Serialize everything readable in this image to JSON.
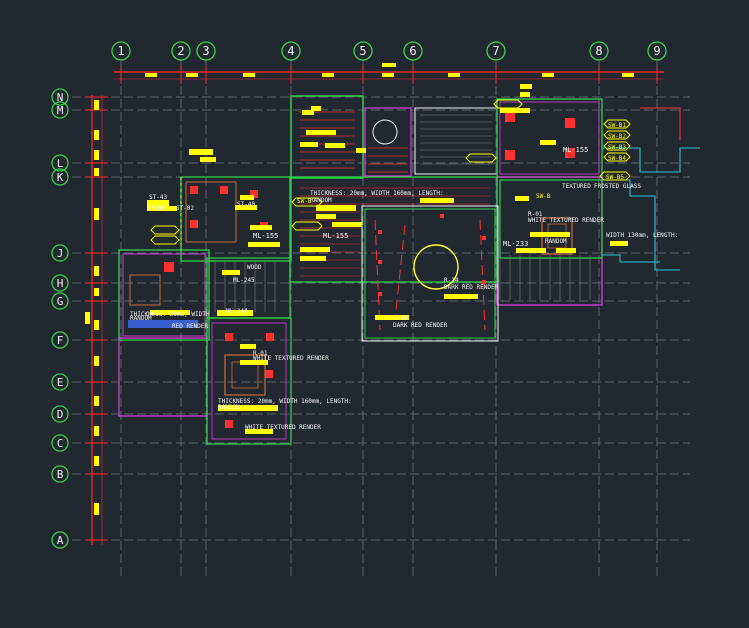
{
  "colors": {
    "background": "#212830",
    "grid": "#5c6670",
    "bubble": "#3cd14a",
    "dimension": "#ff2a2a",
    "highlight": "#ffff00",
    "wall_green": "#2fd14a",
    "wall_magenta": "#e03ce0",
    "wall_red": "#ff3030",
    "glass_cyan": "#2bc6d6",
    "circle": "#ffff33",
    "text_white": "#f2f2f2",
    "furniture": "#c86a3a"
  },
  "grid": {
    "columns": [
      "1",
      "2",
      "3",
      "4",
      "5",
      "6",
      "7",
      "8",
      "9"
    ],
    "rows": [
      "N",
      "M",
      "L",
      "K",
      "J",
      "H",
      "G",
      "F",
      "E",
      "D",
      "C",
      "B",
      "A"
    ]
  },
  "annotations": {
    "st43": "ST-43",
    "stone_st02": "STONE - ST-02",
    "st40": "ST-40",
    "ml155_left": "ML-155",
    "ml155_right": "ML-155",
    "ml155_ne": "ML-155",
    "ml244": "ML-244",
    "ml245": "ML-245",
    "ml233": "ML-233",
    "wood": "WOOD",
    "random_upper": "RANDOM",
    "thickness_upper": "THICKNESS: 20mm, WIDTH 160mm, LENGTH:",
    "random_left": "RANDOM",
    "thickness_left": "THICKNESS: 20mm, WIDTH",
    "red_render_left": "RED RENDER",
    "r01_mid": "R-01",
    "white_textured_mid": "WHITE TEXTURED RENDER",
    "thickness_lower": "THICKNESS: 20mm, WIDTH 160mm, LENGTH:",
    "random_lower": "RANDOM",
    "white_textured_lower": "WHITE TEXTURED RENDER",
    "r14_center": "R-14",
    "dark_red_center": "DARK RED RENDER",
    "r14_right": "R-14",
    "dark_red_right": "DARK RED RENDER",
    "r01_ne": "R-01",
    "white_textured_ne": "WHITE TEXTURED RENDER",
    "random_ne": "RANDOM",
    "frosted_glass": "FROSTED GLASS",
    "width_130": "WIDTH 130mm, LENGTH:",
    "textured_ne": "TEXTURED",
    "swb_stair": "SW-B",
    "swb_ne": "SW-B"
  },
  "tags": [
    "SW-B1",
    "SW-B2",
    "SW-B3",
    "SW-B4",
    "SW-B5"
  ]
}
